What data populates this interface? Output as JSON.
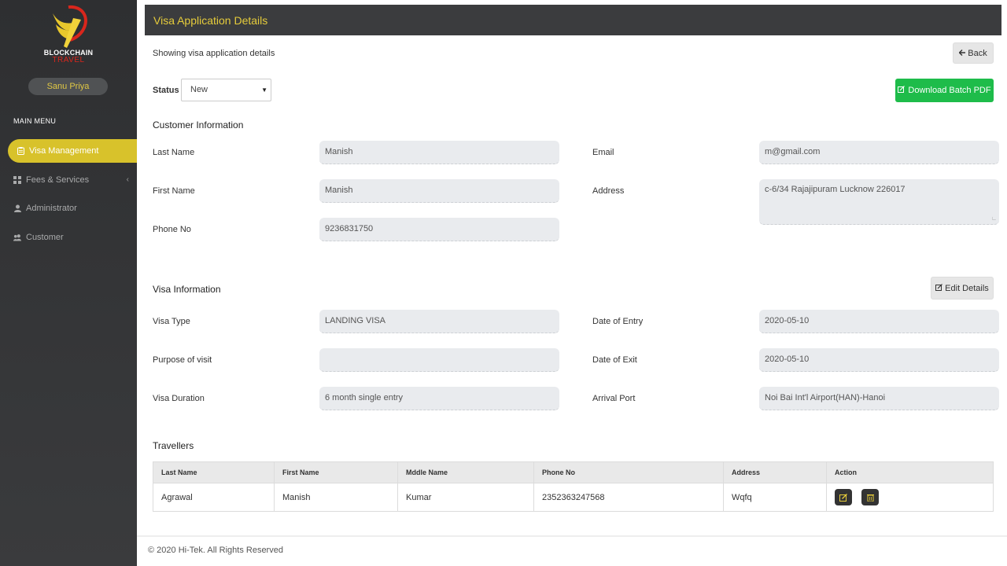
{
  "app": {
    "logo_text_1": "BLOCKCHAIN",
    "logo_text_2": "TRAVEL",
    "user_name": "Sanu Priya"
  },
  "sidebar": {
    "menu_title": "MAIN MENU",
    "items": [
      {
        "label": "Visa Management",
        "icon": "clipboard-icon",
        "active": true
      },
      {
        "label": "Fees & Services",
        "icon": "grid-icon",
        "active": false,
        "has_chevron": true
      },
      {
        "label": "Administrator",
        "icon": "user-icon",
        "active": false
      },
      {
        "label": "Customer",
        "icon": "users-icon",
        "active": false
      }
    ]
  },
  "header": {
    "title": "Visa Application Details",
    "subtitle": "Showing visa application details",
    "back_label": "Back",
    "download_label": "Download Batch PDF"
  },
  "status": {
    "label": "Status",
    "selected": "New"
  },
  "customer": {
    "section_title": "Customer Information",
    "last_name_label": "Last Name",
    "last_name": "Manish",
    "first_name_label": "First Name",
    "first_name": "Manish",
    "phone_label": "Phone No",
    "phone": "9236831750",
    "email_label": "Email",
    "email": "m@gmail.com",
    "address_label": "Address",
    "address": "c-6/34 Rajajipuram Lucknow 226017"
  },
  "visa": {
    "section_title": "Visa Information",
    "edit_label": "Edit Details",
    "type_label": "Visa Type",
    "type": "LANDING VISA",
    "purpose_label": "Purpose of visit",
    "purpose": "",
    "duration_label": "Visa Duration",
    "duration": "6 month single entry",
    "entry_label": "Date of Entry",
    "entry": "2020-05-10",
    "exit_label": "Date of Exit",
    "exit": "2020-05-10",
    "port_label": "Arrival Port",
    "port": "Noi Bai Int'l Airport(HAN)-Hanoi"
  },
  "travellers": {
    "section_title": "Travellers",
    "columns": [
      "Last Name",
      "First Name",
      "Mddle Name",
      "Phone No",
      "Address",
      "Action"
    ],
    "rows": [
      [
        "Agrawal",
        "Manish",
        "Kumar",
        "2352363247568",
        "Wqfq"
      ]
    ]
  },
  "footer": {
    "text": "© 2020 Hi-Tek. All Rights Reserved"
  },
  "colors": {
    "sidebar_bg": "#2e2f31",
    "accent_yellow": "#d8c22b",
    "topbar_bg": "#3b3c3e",
    "title_yellow": "#e6cc3b",
    "download_green": "#1ebc4a",
    "logo_red": "#d9261c"
  }
}
